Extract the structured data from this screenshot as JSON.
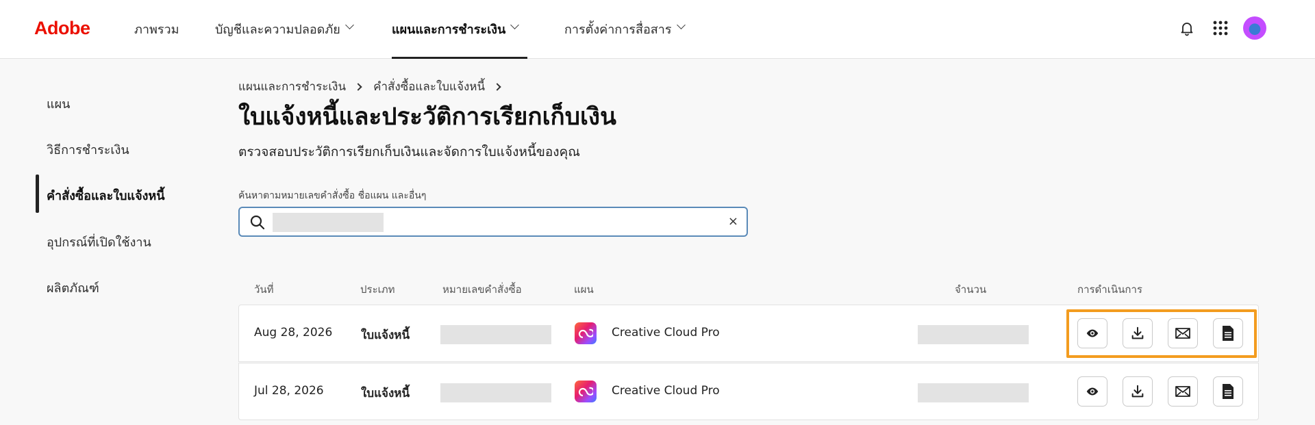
{
  "brand": {
    "logo": "Adobe",
    "color": "#eb1000"
  },
  "nav": {
    "items": [
      {
        "label": "ภาพรวม",
        "dropdown": false,
        "active": false
      },
      {
        "label": "บัญชีและความปลอดภัย",
        "dropdown": true,
        "active": false
      },
      {
        "label": "แผนและการชำระเงิน",
        "dropdown": true,
        "active": true
      },
      {
        "label": "การตั้งค่าการสื่อสาร",
        "dropdown": true,
        "active": false
      }
    ],
    "icons": [
      "bell-icon",
      "apps-grid-icon",
      "avatar"
    ]
  },
  "sidebar": {
    "items": [
      {
        "label": "แผน",
        "active": false
      },
      {
        "label": "วิธีการชำระเงิน",
        "active": false
      },
      {
        "label": "คำสั่งซื้อและใบแจ้งหนี้",
        "active": true
      },
      {
        "label": "อุปกรณ์ที่เปิดใช้งาน",
        "active": false
      },
      {
        "label": "ผลิตภัณฑ์",
        "active": false
      }
    ]
  },
  "breadcrumb": [
    "แผนและการชำระเงิน",
    "คำสั่งซื้อและใบแจ้งหนี้"
  ],
  "page": {
    "title": "ใบแจ้งหนี้และประวัติการเรียกเก็บเงิน",
    "subtitle": "ตรวจสอบประวัติการเรียกเก็บเงินและจัดการใบแจ้งหนี้ของคุณ"
  },
  "search": {
    "label": "ค้นหาตามหมายเลขคำสั่งซื้อ ชื่อแผน และอื่นๆ",
    "value": "",
    "clear": "×"
  },
  "table": {
    "columns": [
      "วันที่",
      "ประเภท",
      "หมายเลขคำสั่งซื้อ",
      "แผน",
      "จำนวน",
      "การดำเนินการ"
    ],
    "rows": [
      {
        "date": "Aug 28, 2026",
        "type": "ใบแจ้งหนี้",
        "order_number": "",
        "plan": "Creative Cloud Pro",
        "amount": ""
      },
      {
        "date": "Jul 28, 2026",
        "type": "ใบแจ้งหนี้",
        "order_number": "",
        "plan": "Creative Cloud Pro",
        "amount": ""
      }
    ],
    "actions": [
      "view-icon",
      "download-icon",
      "email-icon",
      "document-icon"
    ]
  },
  "highlight_color": "#f39c1f"
}
